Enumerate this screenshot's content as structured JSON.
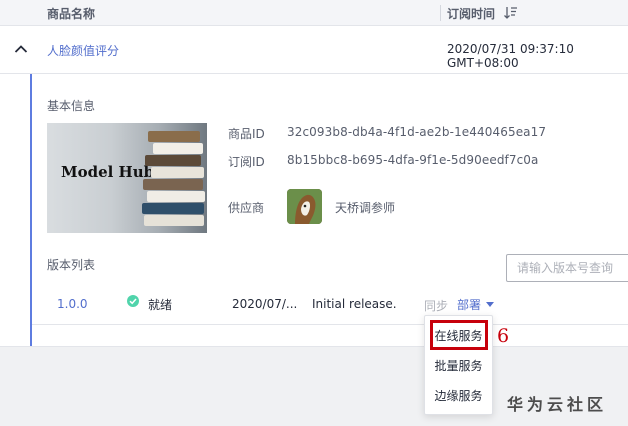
{
  "table_header": {
    "product_name": "商品名称",
    "subscribe_time": "订阅时间"
  },
  "product": {
    "name": "人脸颜值评分",
    "subscribe_time": "2020/07/31 09:37:10 GMT+08:00"
  },
  "detail": {
    "basic_info_title": "基本信息",
    "cover_text": "Model Hub",
    "product_id_label": "商品ID",
    "product_id_value": "32c093b8-db4a-4f1d-ae2b-1e440465ea17",
    "subscribe_id_label": "订阅ID",
    "subscribe_id_value": "8b15bbc8-b695-4dfa-9f1e-5d90eedf7c0a",
    "supplier_label": "供应商",
    "supplier_name": "天桥调参师"
  },
  "versions": {
    "title": "版本列表",
    "search_placeholder": "请输入版本号查询",
    "rows": [
      {
        "version": "1.0.0",
        "status": "就绪",
        "status_color": "#50d4ab",
        "date": "2020/07/...",
        "description": "Initial release.",
        "sync_label": "同步",
        "deploy_label": "部署"
      }
    ]
  },
  "deploy_menu": {
    "items": [
      "在线服务",
      "批量服务",
      "边缘服务"
    ],
    "highlighted_index": 0,
    "step_number": "6"
  },
  "watermark": "华为云社区",
  "colors": {
    "link": "#526ecc",
    "accent_border": "#5e7ce0",
    "highlight": "#c7000b"
  }
}
